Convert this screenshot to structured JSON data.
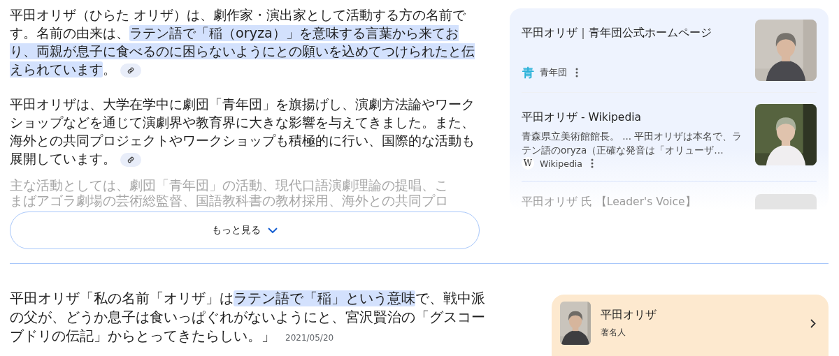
{
  "answer": {
    "paragraphs": [
      {
        "segments": [
          {
            "text": "平田オリザ（ひらた オリザ）は、劇作家・演出家として活動する方の名前です。名前の由来は、",
            "highlighted": false
          },
          {
            "text": "ラテン語で「稲（oryza）」を意味する言葉から来ており、両親が息子に食べるのに困らないようにとの願いを込めてつけられたと伝えられています",
            "highlighted": true
          },
          {
            "text": "。",
            "highlighted": false
          }
        ],
        "citation": true
      },
      {
        "segments": [
          {
            "text": "平田オリザは、大学在学中に劇団「青年団」を旗揚げし、演劇方法論やワークショップなどを通じて演劇界や教育界に大きな影響を与えてきました。また、海外との共同プロジェクトやワークショップも積極的に行い、国際的な活動も展開しています。",
            "highlighted": false
          }
        ],
        "citation": true
      }
    ],
    "faded_lines": [
      "主な活動としては、劇団「青年団」の活動、現代口語演劇理論の提唱、こ",
      "まばアゴラ劇場の芸術総監督、国語教科書の教材採用、海外との共同プロ"
    ],
    "more_button": {
      "label": "もっと見る"
    }
  },
  "sources": [
    {
      "title": "平田オリザ｜青年団公式ホームページ",
      "favicon": "青",
      "site": "青年団",
      "kind": "photo-gray"
    },
    {
      "title": "平田オリザ - Wikipedia",
      "snippet": "青森県立美術館館長。 ... 平田オリザは本名で、ラテン語のoryza（正確な発音は「オリューザ…",
      "favicon": "W",
      "site": "Wikipedia",
      "kind": "photo-green"
    }
  ],
  "sources_peek": {
    "title": "平田オリザ 氏 【Leader's Voice】"
  },
  "quote": {
    "segments": [
      {
        "text": "平田オリザ「私の名前「オリザ」は",
        "highlighted": false
      },
      {
        "text": "ラテン語で「稲」という意味",
        "highlighted": true
      },
      {
        "text": "で、戦中派の父が、どうか息子は食いっぱぐれがないようにと、宮沢賢治の「グスコーブドリの伝記」からとってきたらしい。」",
        "highlighted": false
      }
    ],
    "date": "2021/05/20"
  },
  "entity": {
    "name": "平田オリザ",
    "category": "著名人"
  }
}
